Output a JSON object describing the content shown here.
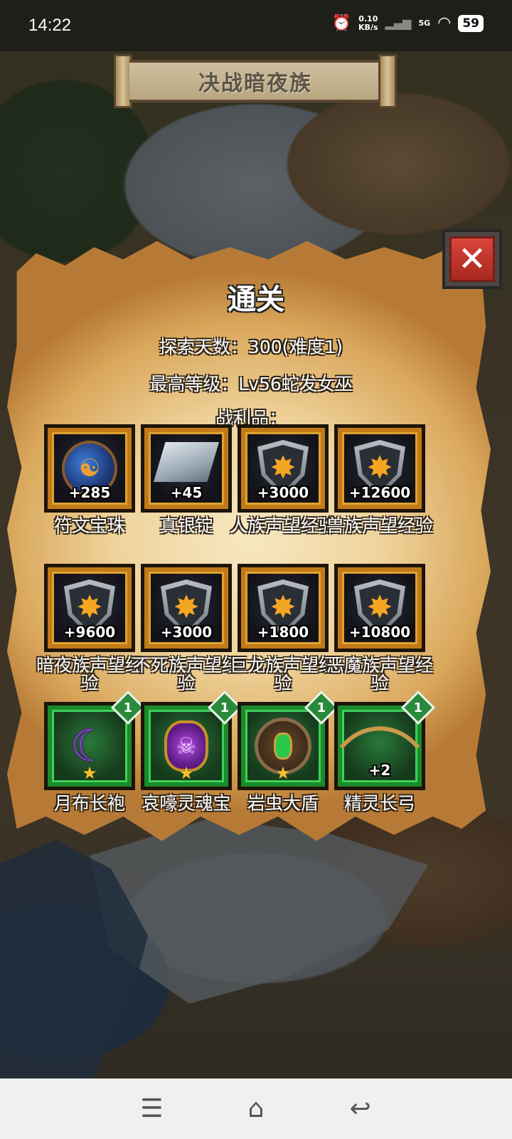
{
  "status_bar": {
    "time": "14:22",
    "net_speed_value": "0.10",
    "net_speed_unit": "KB/s",
    "network_type": "5G",
    "battery": "59"
  },
  "banner": {
    "title": "决战暗夜族"
  },
  "panel": {
    "title": "通关",
    "days_line": "探索天数：300(难度1)",
    "level_line": "最高等级：Lv56蛇发女巫",
    "loot_header": "战利品："
  },
  "loot": [
    {
      "name": "符文宝珠",
      "qty": "+285",
      "icon": "rune-orb-icon"
    },
    {
      "name": "真银锭",
      "qty": "+45",
      "icon": "silver-ingot-icon"
    },
    {
      "name": "人族声望经验",
      "qty": "+3000",
      "icon": "reputation-shield-icon"
    },
    {
      "name": "兽族声望经验",
      "qty": "+12600",
      "icon": "reputation-shield-icon"
    },
    {
      "name": "暗夜族声望经验",
      "qty": "+9600",
      "icon": "reputation-shield-icon"
    },
    {
      "name": "不死族声望经验",
      "qty": "+3000",
      "icon": "reputation-shield-icon"
    },
    {
      "name": "巨龙族声望经验",
      "qty": "+1800",
      "icon": "reputation-shield-icon"
    },
    {
      "name": "恶魔族声望经验",
      "qty": "+10800",
      "icon": "reputation-shield-icon"
    },
    {
      "name": "月布长袍",
      "qty": "",
      "badge": "1",
      "icon": "moon-robe-icon"
    },
    {
      "name": "哀嚎灵魂宝",
      "qty": "",
      "badge": "1",
      "icon": "soul-amulet-icon"
    },
    {
      "name": "岩虫大盾",
      "qty": "",
      "badge": "1",
      "icon": "rockworm-shield-icon"
    },
    {
      "name": "精灵长弓",
      "qty": "+2",
      "badge": "1",
      "icon": "elven-longbow-icon"
    }
  ],
  "colors": {
    "parchment": "#efd39c",
    "slot_gold": "#c07a18",
    "slot_green": "#1b8a2a",
    "close_red": "#d9453a"
  }
}
